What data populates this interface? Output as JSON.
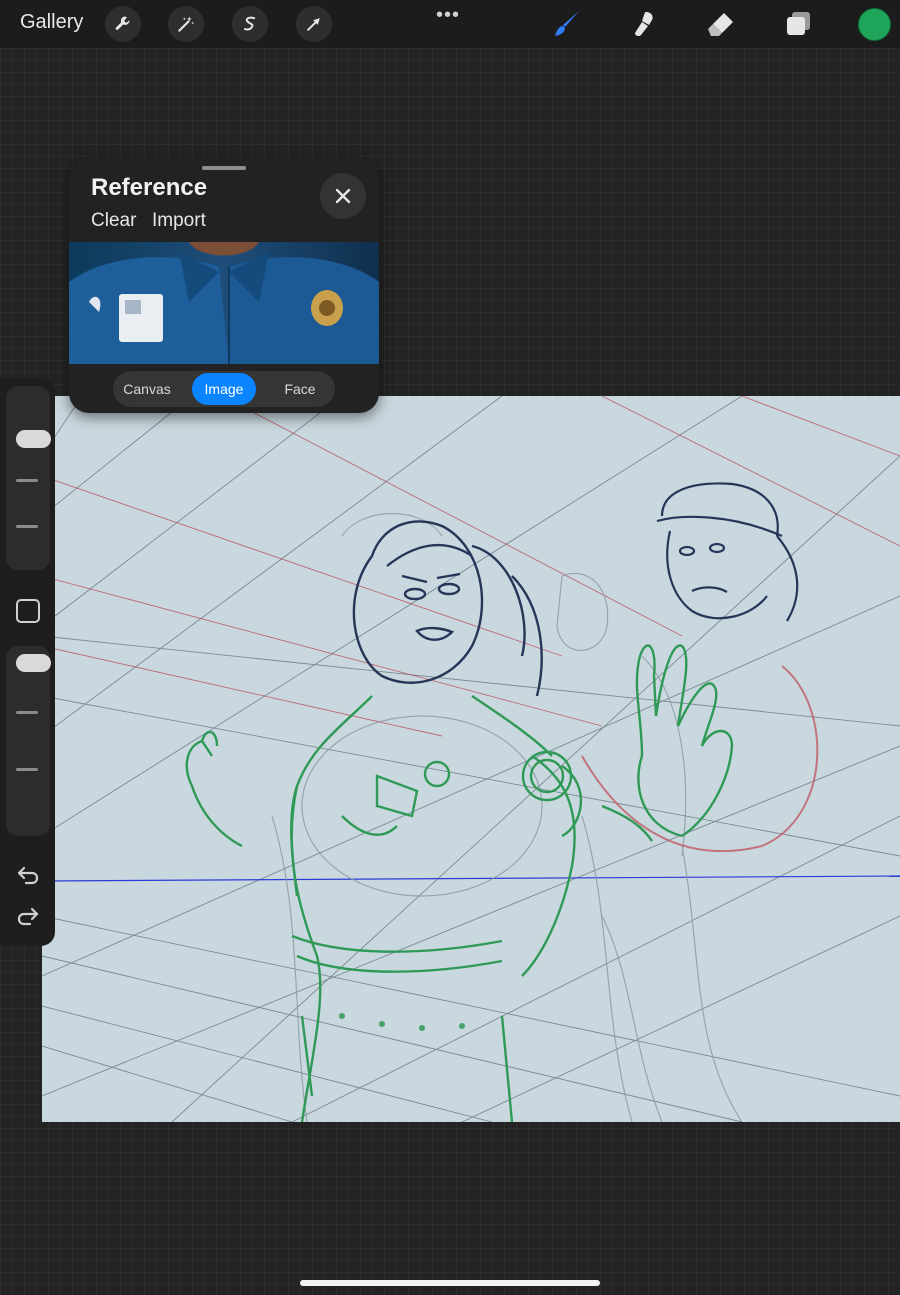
{
  "toolbar": {
    "gallery_label": "Gallery",
    "more_label": "•••",
    "left_tools": [
      "wrench-icon",
      "magic-wand-icon",
      "selection-icon",
      "transform-arrow-icon"
    ],
    "right_tools": [
      "brush-icon",
      "smudge-icon",
      "eraser-icon",
      "layers-icon"
    ],
    "active_tool": "brush-icon",
    "current_color": "#1fa55a",
    "accent": "#0a84ff"
  },
  "sidebar": {
    "brush_size_level": 0.9,
    "opacity_level": 0.9,
    "icons": [
      "modify-square-icon",
      "undo-icon",
      "redo-icon"
    ]
  },
  "reference": {
    "title": "Reference",
    "clear_label": "Clear",
    "import_label": "Import",
    "close_icon": "close-icon",
    "tabs": [
      {
        "label": "Canvas",
        "active": false
      },
      {
        "label": "Image",
        "active": true
      },
      {
        "label": "Face",
        "active": false
      }
    ]
  }
}
